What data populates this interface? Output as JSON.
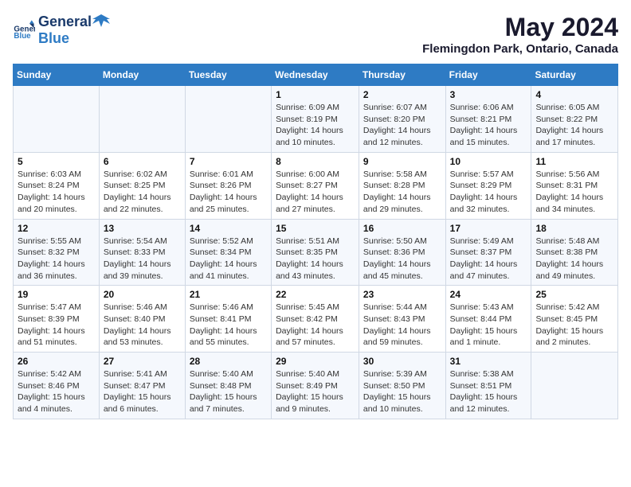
{
  "header": {
    "logo_general": "General",
    "logo_blue": "Blue",
    "title": "May 2024",
    "subtitle": "Flemingdon Park, Ontario, Canada"
  },
  "weekdays": [
    "Sunday",
    "Monday",
    "Tuesday",
    "Wednesday",
    "Thursday",
    "Friday",
    "Saturday"
  ],
  "weeks": [
    [
      {
        "day": "",
        "info": ""
      },
      {
        "day": "",
        "info": ""
      },
      {
        "day": "",
        "info": ""
      },
      {
        "day": "1",
        "info": "Sunrise: 6:09 AM\nSunset: 8:19 PM\nDaylight: 14 hours\nand 10 minutes."
      },
      {
        "day": "2",
        "info": "Sunrise: 6:07 AM\nSunset: 8:20 PM\nDaylight: 14 hours\nand 12 minutes."
      },
      {
        "day": "3",
        "info": "Sunrise: 6:06 AM\nSunset: 8:21 PM\nDaylight: 14 hours\nand 15 minutes."
      },
      {
        "day": "4",
        "info": "Sunrise: 6:05 AM\nSunset: 8:22 PM\nDaylight: 14 hours\nand 17 minutes."
      }
    ],
    [
      {
        "day": "5",
        "info": "Sunrise: 6:03 AM\nSunset: 8:24 PM\nDaylight: 14 hours\nand 20 minutes."
      },
      {
        "day": "6",
        "info": "Sunrise: 6:02 AM\nSunset: 8:25 PM\nDaylight: 14 hours\nand 22 minutes."
      },
      {
        "day": "7",
        "info": "Sunrise: 6:01 AM\nSunset: 8:26 PM\nDaylight: 14 hours\nand 25 minutes."
      },
      {
        "day": "8",
        "info": "Sunrise: 6:00 AM\nSunset: 8:27 PM\nDaylight: 14 hours\nand 27 minutes."
      },
      {
        "day": "9",
        "info": "Sunrise: 5:58 AM\nSunset: 8:28 PM\nDaylight: 14 hours\nand 29 minutes."
      },
      {
        "day": "10",
        "info": "Sunrise: 5:57 AM\nSunset: 8:29 PM\nDaylight: 14 hours\nand 32 minutes."
      },
      {
        "day": "11",
        "info": "Sunrise: 5:56 AM\nSunset: 8:31 PM\nDaylight: 14 hours\nand 34 minutes."
      }
    ],
    [
      {
        "day": "12",
        "info": "Sunrise: 5:55 AM\nSunset: 8:32 PM\nDaylight: 14 hours\nand 36 minutes."
      },
      {
        "day": "13",
        "info": "Sunrise: 5:54 AM\nSunset: 8:33 PM\nDaylight: 14 hours\nand 39 minutes."
      },
      {
        "day": "14",
        "info": "Sunrise: 5:52 AM\nSunset: 8:34 PM\nDaylight: 14 hours\nand 41 minutes."
      },
      {
        "day": "15",
        "info": "Sunrise: 5:51 AM\nSunset: 8:35 PM\nDaylight: 14 hours\nand 43 minutes."
      },
      {
        "day": "16",
        "info": "Sunrise: 5:50 AM\nSunset: 8:36 PM\nDaylight: 14 hours\nand 45 minutes."
      },
      {
        "day": "17",
        "info": "Sunrise: 5:49 AM\nSunset: 8:37 PM\nDaylight: 14 hours\nand 47 minutes."
      },
      {
        "day": "18",
        "info": "Sunrise: 5:48 AM\nSunset: 8:38 PM\nDaylight: 14 hours\nand 49 minutes."
      }
    ],
    [
      {
        "day": "19",
        "info": "Sunrise: 5:47 AM\nSunset: 8:39 PM\nDaylight: 14 hours\nand 51 minutes."
      },
      {
        "day": "20",
        "info": "Sunrise: 5:46 AM\nSunset: 8:40 PM\nDaylight: 14 hours\nand 53 minutes."
      },
      {
        "day": "21",
        "info": "Sunrise: 5:46 AM\nSunset: 8:41 PM\nDaylight: 14 hours\nand 55 minutes."
      },
      {
        "day": "22",
        "info": "Sunrise: 5:45 AM\nSunset: 8:42 PM\nDaylight: 14 hours\nand 57 minutes."
      },
      {
        "day": "23",
        "info": "Sunrise: 5:44 AM\nSunset: 8:43 PM\nDaylight: 14 hours\nand 59 minutes."
      },
      {
        "day": "24",
        "info": "Sunrise: 5:43 AM\nSunset: 8:44 PM\nDaylight: 15 hours\nand 1 minute."
      },
      {
        "day": "25",
        "info": "Sunrise: 5:42 AM\nSunset: 8:45 PM\nDaylight: 15 hours\nand 2 minutes."
      }
    ],
    [
      {
        "day": "26",
        "info": "Sunrise: 5:42 AM\nSunset: 8:46 PM\nDaylight: 15 hours\nand 4 minutes."
      },
      {
        "day": "27",
        "info": "Sunrise: 5:41 AM\nSunset: 8:47 PM\nDaylight: 15 hours\nand 6 minutes."
      },
      {
        "day": "28",
        "info": "Sunrise: 5:40 AM\nSunset: 8:48 PM\nDaylight: 15 hours\nand 7 minutes."
      },
      {
        "day": "29",
        "info": "Sunrise: 5:40 AM\nSunset: 8:49 PM\nDaylight: 15 hours\nand 9 minutes."
      },
      {
        "day": "30",
        "info": "Sunrise: 5:39 AM\nSunset: 8:50 PM\nDaylight: 15 hours\nand 10 minutes."
      },
      {
        "day": "31",
        "info": "Sunrise: 5:38 AM\nSunset: 8:51 PM\nDaylight: 15 hours\nand 12 minutes."
      },
      {
        "day": "",
        "info": ""
      }
    ]
  ]
}
